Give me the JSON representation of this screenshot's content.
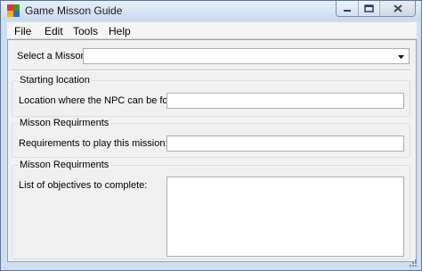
{
  "window": {
    "title": "Game Misson Guide",
    "icon": "windows-form-icon",
    "controls": [
      "minimize-icon",
      "maximize-icon",
      "close-icon"
    ]
  },
  "menu": {
    "items": [
      {
        "label": "File"
      },
      {
        "label": "Edit"
      },
      {
        "label": "Tools"
      },
      {
        "label": "Help"
      }
    ]
  },
  "mission_select": {
    "label": "Select a Misson:",
    "value": ""
  },
  "groups": {
    "starting_location": {
      "title": "Starting location",
      "field_label": "Location where the NPC can be found:",
      "value": ""
    },
    "requirements": {
      "title": "Misson Requirments",
      "field_label": "Requirements to play this mission:",
      "value": ""
    },
    "objectives": {
      "title": "Misson Requirments",
      "field_label": "List of objectives to complete:",
      "value": ""
    }
  },
  "colors": {
    "window_frame": "#bfd4ea",
    "client_background": "#f0f0f0",
    "menubar_background": "#f5f5f5"
  }
}
